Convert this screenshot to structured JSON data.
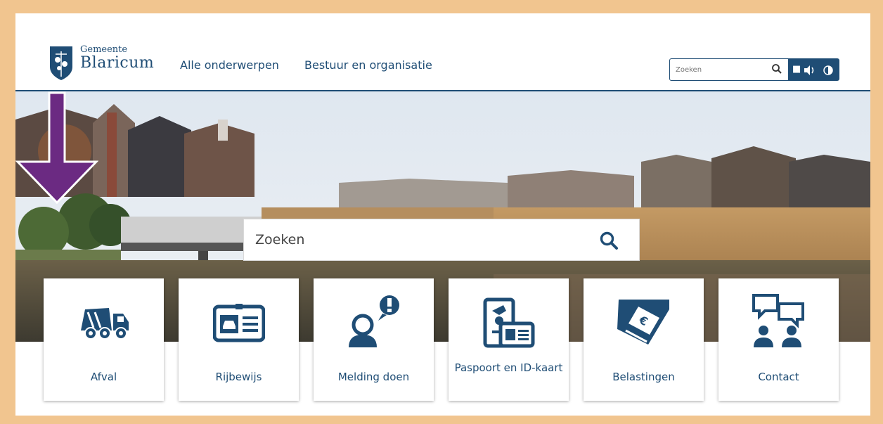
{
  "header": {
    "logo_small": "Gemeente",
    "logo_big": "Blaricum",
    "nav": [
      "Alle onderwerpen",
      "Bestuur en organisatie"
    ],
    "search_placeholder": "Zoeken",
    "utility_icons": [
      "search-icon",
      "stop-icon",
      "speaker-icon",
      "contrast-icon"
    ]
  },
  "hero": {
    "search_placeholder": "Zoeken",
    "annotation": "purple-arrow-down"
  },
  "tiles": [
    {
      "label": "Afval",
      "icon": "garbage-truck-icon"
    },
    {
      "label": "Rijbewijs",
      "icon": "drivers-license-icon"
    },
    {
      "label": "Melding doen",
      "icon": "person-alert-icon"
    },
    {
      "label": "Paspoort en ID-kaart",
      "icon": "passport-id-icon"
    },
    {
      "label": "Belastingen",
      "icon": "tax-ticket-icon"
    },
    {
      "label": "Contact",
      "icon": "contact-chat-icon"
    }
  ],
  "colors": {
    "brand": "#1f4d75",
    "frame": "#f1c58f",
    "arrow": "#6b2a82"
  }
}
